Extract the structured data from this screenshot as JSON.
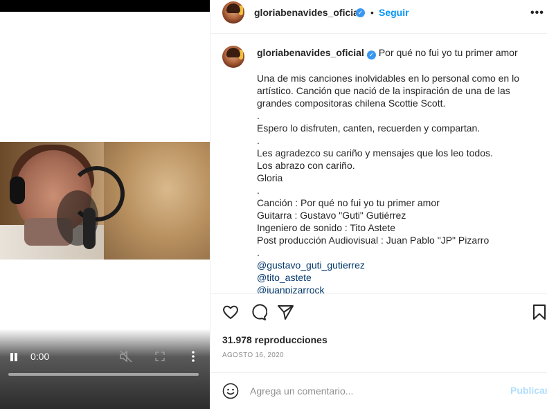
{
  "video": {
    "current_time": "0:00",
    "progress": 0
  },
  "header": {
    "username": "gloriabenavides_oficial",
    "dot": "•",
    "follow_label": "Seguir",
    "more_label": "•••"
  },
  "caption": {
    "username": "gloriabenavides_oficial",
    "title": "Por qué no fui yo tu primer amor",
    "lines": [
      "Una de mis canciones inolvidables en lo personal como en lo artístico. Canción que nació de la inspiración de una de las grandes compositoras chilena Scottie Scott.",
      ".",
      "Espero lo disfruten, canten, recuerden y compartan.",
      ".",
      "Les agradezco su cariño y mensajes que los leo todos.",
      "Los abrazo con cariño.",
      "Gloria",
      ".",
      "Canción : Por qué no fui yo tu primer amor",
      "Guitarra : Gustavo \"Guti\" Gutiérrez",
      "Ingeniero de sonido : Tito Astete",
      "Post producción Audiovisual : Juan Pablo \"JP\" Pizarro",
      "."
    ],
    "mentions": [
      "@gustavo_guti_gutierrez",
      "@tito_astete",
      "@juanpizarrock"
    ]
  },
  "stats": {
    "views": "31.978 reproducciones",
    "date": "AGOSTO 16, 2020"
  },
  "comment": {
    "placeholder": "Agrega un comentario...",
    "publish_label": "Publicar"
  },
  "colors": {
    "link": "#0095f6",
    "verified": "#3897f0",
    "publish_disabled": "#b2dffc",
    "mention": "#00376b"
  },
  "icons": {
    "like": "heart-icon",
    "comment": "comment-icon",
    "share": "paper-plane-icon",
    "save": "bookmark-icon",
    "emoji": "emoji-icon",
    "verified": "verified-badge-icon",
    "pause": "pause-icon",
    "mute": "volume-muted-icon",
    "fullscreen": "fullscreen-icon",
    "more": "more-vertical-icon"
  }
}
